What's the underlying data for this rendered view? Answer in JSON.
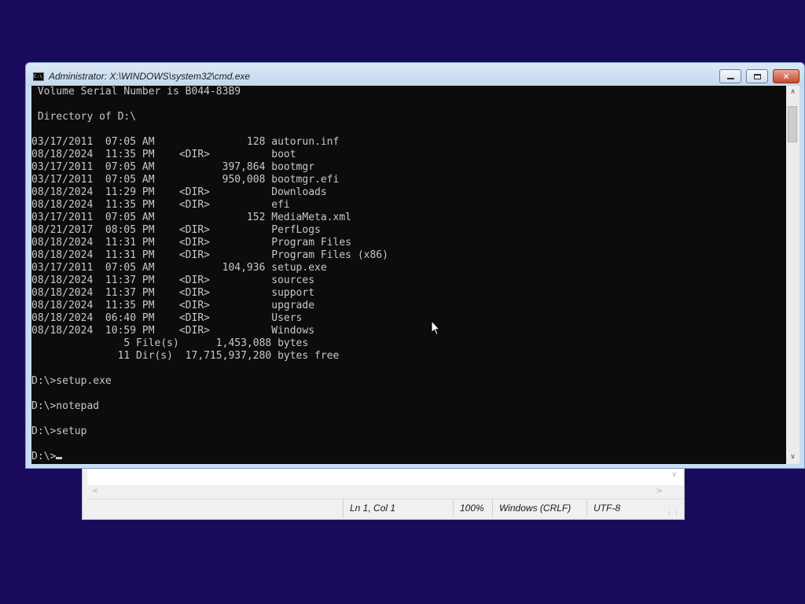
{
  "notepad": {
    "status_position": "Ln 1, Col 1",
    "status_zoom": "100%",
    "status_line_endings": "Windows (CRLF)",
    "status_encoding": "UTF-8"
  },
  "cmd": {
    "title": "Administrator: X:\\WINDOWS\\system32\\cmd.exe",
    "icon_label": "C:\\",
    "serial_line": " Volume Serial Number is B044-83B9",
    "directory_line": " Directory of D:\\",
    "listing": [
      "03/17/2011  07:05 AM               128 autorun.inf",
      "08/18/2024  11:35 PM    <DIR>          boot",
      "03/17/2011  07:05 AM           397,864 bootmgr",
      "03/17/2011  07:05 AM           950,008 bootmgr.efi",
      "08/18/2024  11:29 PM    <DIR>          Downloads",
      "08/18/2024  11:35 PM    <DIR>          efi",
      "03/17/2011  07:05 AM               152 MediaMeta.xml",
      "08/21/2017  08:05 PM    <DIR>          PerfLogs",
      "08/18/2024  11:31 PM    <DIR>          Program Files",
      "08/18/2024  11:31 PM    <DIR>          Program Files (x86)",
      "03/17/2011  07:05 AM           104,936 setup.exe",
      "08/18/2024  11:37 PM    <DIR>          sources",
      "08/18/2024  11:37 PM    <DIR>          support",
      "08/18/2024  11:35 PM    <DIR>          upgrade",
      "08/18/2024  06:40 PM    <DIR>          Users",
      "08/18/2024  10:59 PM    <DIR>          Windows"
    ],
    "files_summary": "               5 File(s)      1,453,088 bytes",
    "dirs_summary": "              11 Dir(s)  17,715,937,280 bytes free",
    "commands": [
      "D:\\>setup.exe",
      "D:\\>notepad",
      "D:\\>setup"
    ],
    "prompt": "D:\\>"
  },
  "colors": {
    "desktop": "#1a0a5c",
    "console_bg": "#0c0c0c",
    "console_fg": "#c8c8c8"
  }
}
